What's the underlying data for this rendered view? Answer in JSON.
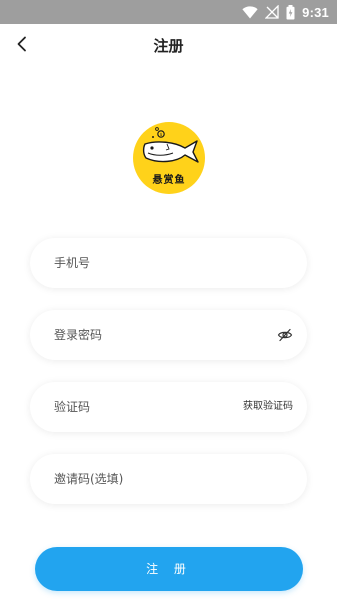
{
  "status_bar": {
    "time": "9:31",
    "icons": [
      "wifi-icon",
      "signal-off-icon",
      "battery-icon"
    ]
  },
  "header": {
    "title": "注册",
    "back_icon": "chevron-left-icon"
  },
  "logo": {
    "text": "悬赏鱼",
    "background_color": "#ffd21a"
  },
  "form": {
    "phone_placeholder": "手机号",
    "password_placeholder": "登录密码",
    "password_toggle_icon": "eye-off-icon",
    "code_placeholder": "验证码",
    "get_code_label": "获取验证码",
    "invite_placeholder": "邀请码(选填)"
  },
  "submit": {
    "label": "注 册",
    "color": "#22a4ef"
  }
}
